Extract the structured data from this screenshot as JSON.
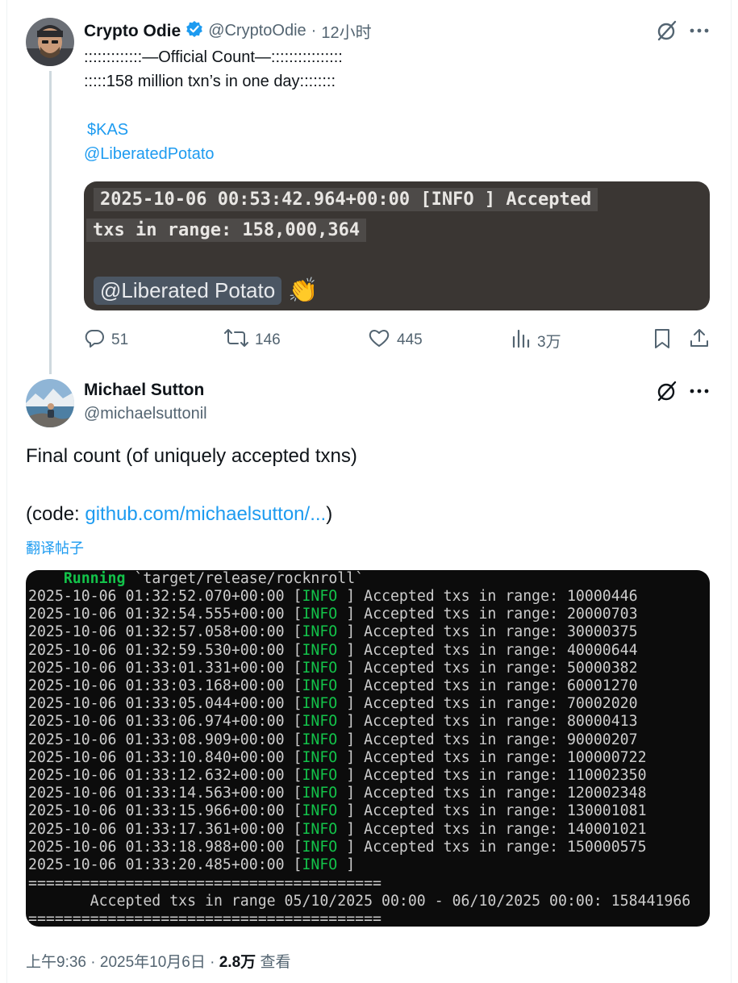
{
  "tweet1": {
    "name": "Crypto Odie",
    "handle": "@CryptoOdie",
    "separator": "·",
    "time": "12小时",
    "line1": ":::::::::::::—Official Count—::::::::::::::::",
    "line2": ":::::158 million txn’s in one day::::::::",
    "cashtag": "$KAS",
    "mention": "@LiberatedPotato",
    "embed": {
      "log_line1": "2025-10-06 00:53:42.964+00:00 [INFO ] Accepted",
      "log_line2": "txs in range: 158,000,364",
      "tag": "@Liberated Potato",
      "emoji": "👏"
    },
    "metrics": {
      "replies": "51",
      "reposts": "146",
      "likes": "445",
      "views": "3万"
    }
  },
  "tweet2": {
    "name": "Michael Sutton",
    "handle": "@michaelsuttonil",
    "text1": "Final count (of uniquely accepted txns)",
    "code_prefix": "(code: ",
    "code_link": "github.com/michaelsutton/...",
    "code_suffix": ")",
    "translate": "翻译帖子",
    "terminal": {
      "running_word": "Running",
      "running_path": "`target/release/rocknroll`",
      "lines": [
        {
          "ts": "2025-10-06 01:32:52.070+00:00",
          "level": "INFO",
          "msg": "Accepted txs in range: 10000446"
        },
        {
          "ts": "2025-10-06 01:32:54.555+00:00",
          "level": "INFO",
          "msg": "Accepted txs in range: 20000703"
        },
        {
          "ts": "2025-10-06 01:32:57.058+00:00",
          "level": "INFO",
          "msg": "Accepted txs in range: 30000375"
        },
        {
          "ts": "2025-10-06 01:32:59.530+00:00",
          "level": "INFO",
          "msg": "Accepted txs in range: 40000644"
        },
        {
          "ts": "2025-10-06 01:33:01.331+00:00",
          "level": "INFO",
          "msg": "Accepted txs in range: 50000382"
        },
        {
          "ts": "2025-10-06 01:33:03.168+00:00",
          "level": "INFO",
          "msg": "Accepted txs in range: 60001270"
        },
        {
          "ts": "2025-10-06 01:33:05.044+00:00",
          "level": "INFO",
          "msg": "Accepted txs in range: 70002020"
        },
        {
          "ts": "2025-10-06 01:33:06.974+00:00",
          "level": "INFO",
          "msg": "Accepted txs in range: 80000413"
        },
        {
          "ts": "2025-10-06 01:33:08.909+00:00",
          "level": "INFO",
          "msg": "Accepted txs in range: 90000207"
        },
        {
          "ts": "2025-10-06 01:33:10.840+00:00",
          "level": "INFO",
          "msg": "Accepted txs in range: 100000722"
        },
        {
          "ts": "2025-10-06 01:33:12.632+00:00",
          "level": "INFO",
          "msg": "Accepted txs in range: 110002350"
        },
        {
          "ts": "2025-10-06 01:33:14.563+00:00",
          "level": "INFO",
          "msg": "Accepted txs in range: 120002348"
        },
        {
          "ts": "2025-10-06 01:33:15.966+00:00",
          "level": "INFO",
          "msg": "Accepted txs in range: 130001081"
        },
        {
          "ts": "2025-10-06 01:33:17.361+00:00",
          "level": "INFO",
          "msg": "Accepted txs in range: 140001021"
        },
        {
          "ts": "2025-10-06 01:33:18.988+00:00",
          "level": "INFO",
          "msg": "Accepted txs in range: 150000575"
        },
        {
          "ts": "2025-10-06 01:33:20.485+00:00",
          "level": "INFO",
          "msg": ""
        }
      ],
      "rule": "========================================",
      "summary": "       Accepted txs in range 05/10/2025 00:00 - 06/10/2025 00:00: 158441966"
    },
    "footer": {
      "time": "上午9:36",
      "separator1": "·",
      "date": "2025年10月6日",
      "separator2": "·",
      "views": "2.8万",
      "views_label": "查看"
    }
  },
  "colors": {
    "link": "#1d9bf0",
    "verified": "#1d9bf0",
    "secondary_text": "#536471",
    "terminal_green": "#13c34a"
  },
  "icons": [
    "verified-badge-icon",
    "grok-icon",
    "more-icon",
    "reply-icon",
    "repost-icon",
    "like-icon",
    "views-icon",
    "bookmark-icon",
    "share-icon",
    "clap-emoji"
  ]
}
